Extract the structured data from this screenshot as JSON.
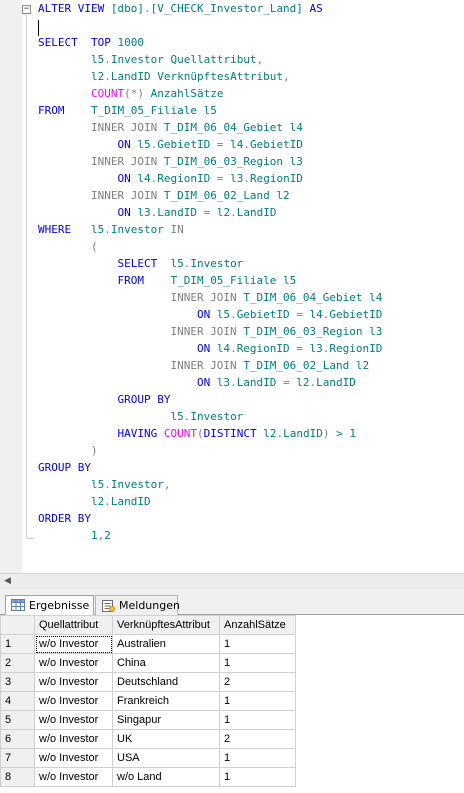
{
  "editor": {
    "lines": [
      [
        {
          "t": "ALTER VIEW ",
          "c": "kw"
        },
        {
          "t": "[dbo]",
          "c": "pl"
        },
        {
          "t": ".",
          "c": "op"
        },
        {
          "t": "[V_CHECK_Investor_Land]",
          "c": "pl"
        },
        {
          "t": " AS",
          "c": "kw"
        }
      ],
      [],
      [
        {
          "t": "SELECT  TOP ",
          "c": "kw"
        },
        {
          "t": "1000",
          "c": "pl"
        }
      ],
      [
        {
          "t": "        l5",
          "c": "pl"
        },
        {
          "t": ".",
          "c": "op"
        },
        {
          "t": "Investor Quellattribut",
          "c": "pl"
        },
        {
          "t": ",",
          "c": "op"
        }
      ],
      [
        {
          "t": "        l2",
          "c": "pl"
        },
        {
          "t": ".",
          "c": "op"
        },
        {
          "t": "LandID VerknüpftesAttribut",
          "c": "pl"
        },
        {
          "t": ",",
          "c": "op"
        }
      ],
      [
        {
          "t": "        COUNT",
          "c": "fn"
        },
        {
          "t": "(*)",
          "c": "op"
        },
        {
          "t": " AnzahlSätze",
          "c": "pl"
        }
      ],
      [
        {
          "t": "FROM    ",
          "c": "kw"
        },
        {
          "t": "T_DIM_05_Filiale l5",
          "c": "pl"
        }
      ],
      [
        {
          "t": "        INNER JOIN ",
          "c": "op"
        },
        {
          "t": "T_DIM_06_04_Gebiet l4",
          "c": "pl"
        }
      ],
      [
        {
          "t": "            ON ",
          "c": "kw"
        },
        {
          "t": "l5",
          "c": "pl"
        },
        {
          "t": ".",
          "c": "op"
        },
        {
          "t": "GebietID ",
          "c": "pl"
        },
        {
          "t": "=",
          "c": "op"
        },
        {
          "t": " l4",
          "c": "pl"
        },
        {
          "t": ".",
          "c": "op"
        },
        {
          "t": "GebietID",
          "c": "pl"
        }
      ],
      [
        {
          "t": "        INNER JOIN ",
          "c": "op"
        },
        {
          "t": "T_DIM_06_03_Region l3",
          "c": "pl"
        }
      ],
      [
        {
          "t": "            ON ",
          "c": "kw"
        },
        {
          "t": "l4",
          "c": "pl"
        },
        {
          "t": ".",
          "c": "op"
        },
        {
          "t": "RegionID ",
          "c": "pl"
        },
        {
          "t": "=",
          "c": "op"
        },
        {
          "t": " l3",
          "c": "pl"
        },
        {
          "t": ".",
          "c": "op"
        },
        {
          "t": "RegionID",
          "c": "pl"
        }
      ],
      [
        {
          "t": "        INNER JOIN ",
          "c": "op"
        },
        {
          "t": "T_DIM_06_02_Land l2",
          "c": "pl"
        }
      ],
      [
        {
          "t": "            ON ",
          "c": "kw"
        },
        {
          "t": "l3",
          "c": "pl"
        },
        {
          "t": ".",
          "c": "op"
        },
        {
          "t": "LandID ",
          "c": "pl"
        },
        {
          "t": "=",
          "c": "op"
        },
        {
          "t": " l2",
          "c": "pl"
        },
        {
          "t": ".",
          "c": "op"
        },
        {
          "t": "LandID",
          "c": "pl"
        }
      ],
      [
        {
          "t": "WHERE   ",
          "c": "kw"
        },
        {
          "t": "l5",
          "c": "pl"
        },
        {
          "t": ".",
          "c": "op"
        },
        {
          "t": "Investor ",
          "c": "pl"
        },
        {
          "t": "IN",
          "c": "op"
        }
      ],
      [
        {
          "t": "        (",
          "c": "op"
        }
      ],
      [
        {
          "t": "            SELECT  ",
          "c": "kw"
        },
        {
          "t": "l5",
          "c": "pl"
        },
        {
          "t": ".",
          "c": "op"
        },
        {
          "t": "Investor",
          "c": "pl"
        }
      ],
      [
        {
          "t": "            FROM    ",
          "c": "kw"
        },
        {
          "t": "T_DIM_05_Filiale l5",
          "c": "pl"
        }
      ],
      [
        {
          "t": "                    INNER JOIN ",
          "c": "op"
        },
        {
          "t": "T_DIM_06_04_Gebiet l4",
          "c": "pl"
        }
      ],
      [
        {
          "t": "                        ON ",
          "c": "kw"
        },
        {
          "t": "l5",
          "c": "pl"
        },
        {
          "t": ".",
          "c": "op"
        },
        {
          "t": "GebietID ",
          "c": "pl"
        },
        {
          "t": "=",
          "c": "op"
        },
        {
          "t": " l4",
          "c": "pl"
        },
        {
          "t": ".",
          "c": "op"
        },
        {
          "t": "GebietID",
          "c": "pl"
        }
      ],
      [
        {
          "t": "                    INNER JOIN ",
          "c": "op"
        },
        {
          "t": "T_DIM_06_03_Region l3",
          "c": "pl"
        }
      ],
      [
        {
          "t": "                        ON ",
          "c": "kw"
        },
        {
          "t": "l4",
          "c": "pl"
        },
        {
          "t": ".",
          "c": "op"
        },
        {
          "t": "RegionID ",
          "c": "pl"
        },
        {
          "t": "=",
          "c": "op"
        },
        {
          "t": " l3",
          "c": "pl"
        },
        {
          "t": ".",
          "c": "op"
        },
        {
          "t": "RegionID",
          "c": "pl"
        }
      ],
      [
        {
          "t": "                    INNER JOIN ",
          "c": "op"
        },
        {
          "t": "T_DIM_06_02_Land l2",
          "c": "pl"
        }
      ],
      [
        {
          "t": "                        ON ",
          "c": "kw"
        },
        {
          "t": "l3",
          "c": "pl"
        },
        {
          "t": ".",
          "c": "op"
        },
        {
          "t": "LandID ",
          "c": "pl"
        },
        {
          "t": "=",
          "c": "op"
        },
        {
          "t": " l2",
          "c": "pl"
        },
        {
          "t": ".",
          "c": "op"
        },
        {
          "t": "LandID",
          "c": "pl"
        }
      ],
      [
        {
          "t": "            GROUP BY",
          "c": "kw"
        }
      ],
      [
        {
          "t": "                    l5",
          "c": "pl"
        },
        {
          "t": ".",
          "c": "op"
        },
        {
          "t": "Investor",
          "c": "pl"
        }
      ],
      [
        {
          "t": "            HAVING ",
          "c": "kw"
        },
        {
          "t": "COUNT",
          "c": "fn"
        },
        {
          "t": "(",
          "c": "op"
        },
        {
          "t": "DISTINCT ",
          "c": "kw"
        },
        {
          "t": "l2",
          "c": "pl"
        },
        {
          "t": ".",
          "c": "op"
        },
        {
          "t": "LandID",
          "c": "pl"
        },
        {
          "t": ")",
          "c": "op"
        },
        {
          "t": " > 1",
          "c": "pl"
        }
      ],
      [
        {
          "t": "        )",
          "c": "op"
        }
      ],
      [
        {
          "t": "GROUP BY",
          "c": "kw"
        }
      ],
      [
        {
          "t": "        l5",
          "c": "pl"
        },
        {
          "t": ".",
          "c": "op"
        },
        {
          "t": "Investor",
          "c": "pl"
        },
        {
          "t": ",",
          "c": "op"
        }
      ],
      [
        {
          "t": "        l2",
          "c": "pl"
        },
        {
          "t": ".",
          "c": "op"
        },
        {
          "t": "LandID",
          "c": "pl"
        }
      ],
      [
        {
          "t": "ORDER BY",
          "c": "kw"
        }
      ],
      [
        {
          "t": "        1",
          "c": "pl"
        },
        {
          "t": ",",
          "c": "op"
        },
        {
          "t": "2",
          "c": "pl"
        }
      ]
    ],
    "collapse_glyph": "−"
  },
  "colors": {
    "keyword": "#0000ff",
    "operator": "#808080",
    "function": "#ff00ff",
    "plain": "#008080"
  },
  "tabs": {
    "results_label": "Ergebnisse",
    "messages_label": "Meldungen"
  },
  "grid": {
    "columns": [
      "",
      "Quellattribut",
      "VerknüpftesAttribut",
      "AnzahlSätze"
    ],
    "rows": [
      [
        "1",
        "w/o Investor",
        "Australien",
        "1"
      ],
      [
        "2",
        "w/o Investor",
        "China",
        "1"
      ],
      [
        "3",
        "w/o Investor",
        "Deutschland",
        "2"
      ],
      [
        "4",
        "w/o Investor",
        "Frankreich",
        "1"
      ],
      [
        "5",
        "w/o Investor",
        "Singapur",
        "1"
      ],
      [
        "6",
        "w/o Investor",
        "UK",
        "2"
      ],
      [
        "7",
        "w/o Investor",
        "USA",
        "1"
      ],
      [
        "8",
        "w/o Investor",
        "w/o Land",
        "1"
      ]
    ]
  }
}
